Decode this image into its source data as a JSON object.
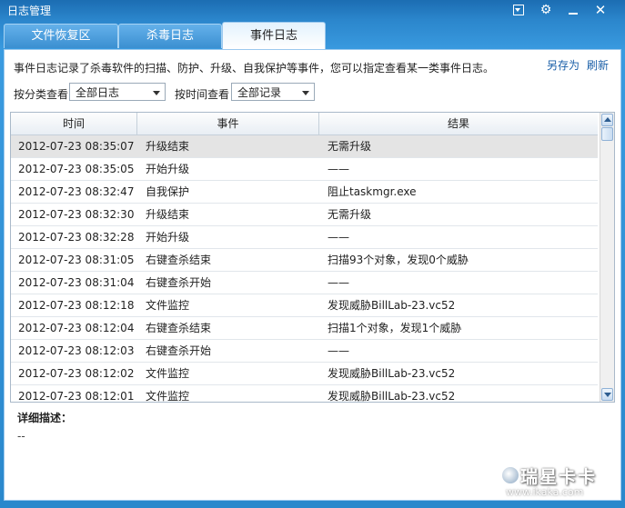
{
  "window": {
    "title": "日志管理"
  },
  "tabs": [
    {
      "label": "文件恢复区"
    },
    {
      "label": "杀毒日志"
    },
    {
      "label": "事件日志"
    }
  ],
  "description": "事件日志记录了杀毒软件的扫描、防护、升级、自我保护等事件，您可以指定查看某一类事件日志。",
  "actions": {
    "save_as": "另存为",
    "refresh": "刷新"
  },
  "filters": {
    "category_label": "按分类查看",
    "category_value": "全部日志",
    "time_label": "按时间查看",
    "time_value": "全部记录"
  },
  "table": {
    "headers": [
      "时间",
      "事件",
      "结果"
    ],
    "rows": [
      {
        "time": "2012-07-23 08:35:07",
        "event": "升级结束",
        "result": "无需升级"
      },
      {
        "time": "2012-07-23 08:35:05",
        "event": "开始升级",
        "result": "——"
      },
      {
        "time": "2012-07-23 08:32:47",
        "event": "自我保护",
        "result": "阻止taskmgr.exe"
      },
      {
        "time": "2012-07-23 08:32:30",
        "event": "升级结束",
        "result": "无需升级"
      },
      {
        "time": "2012-07-23 08:32:28",
        "event": "开始升级",
        "result": "——"
      },
      {
        "time": "2012-07-23 08:31:05",
        "event": "右键查杀结束",
        "result": "扫描93个对象，发现0个威胁"
      },
      {
        "time": "2012-07-23 08:31:04",
        "event": "右键查杀开始",
        "result": "——"
      },
      {
        "time": "2012-07-23 08:12:18",
        "event": "文件监控",
        "result": "发现威胁BillLab-23.vc52"
      },
      {
        "time": "2012-07-23 08:12:04",
        "event": "右键查杀结束",
        "result": "扫描1个对象，发现1个威胁"
      },
      {
        "time": "2012-07-23 08:12:03",
        "event": "右键查杀开始",
        "result": "——"
      },
      {
        "time": "2012-07-23 08:12:02",
        "event": "文件监控",
        "result": "发现威胁BillLab-23.vc52"
      },
      {
        "time": "2012-07-23 08:12:01",
        "event": "文件监控",
        "result": "发现威胁BillLab-23.vc52"
      }
    ]
  },
  "detail": {
    "label": "详细描述：",
    "value": "--"
  },
  "watermark": {
    "line1": "瑞星卡卡",
    "line2": "www.ikaka.com"
  }
}
